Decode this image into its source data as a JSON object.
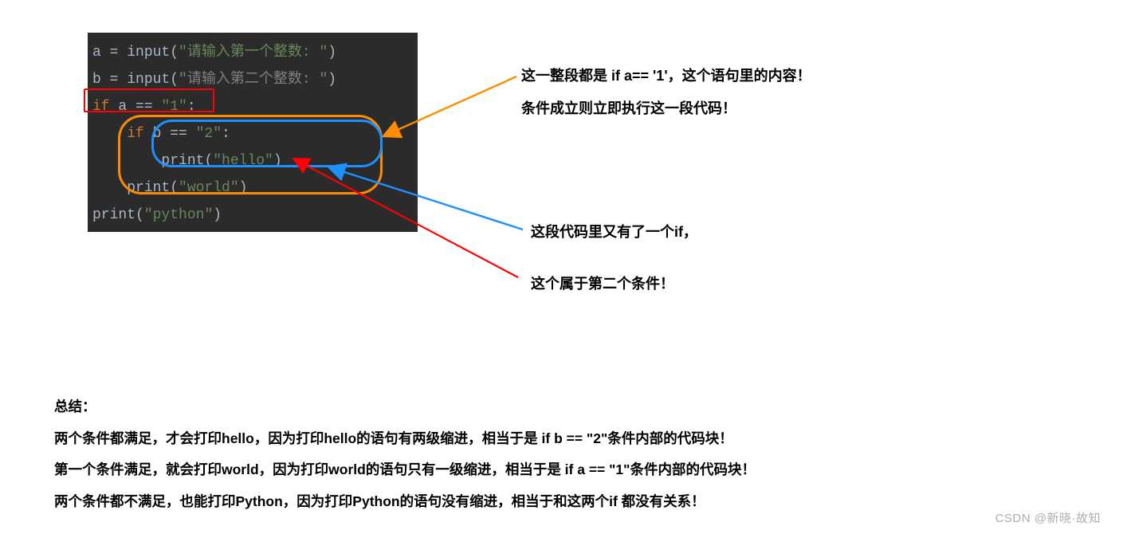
{
  "code": {
    "l1_a": "a = ",
    "l1_b": "input",
    "l1_c": "(",
    "l1_d": "\"请输入第一个整数: \"",
    "l1_e": ")",
    "l2_a": "b = ",
    "l2_b": "input",
    "l2_c": "(",
    "l2_d": "\"请输入第二个整数: \"",
    "l2_e": ")",
    "l3_a": "if",
    "l3_b": " a == ",
    "l3_c": "\"1\"",
    "l3_d": ":",
    "l4_a": "    if",
    "l4_b": " b == ",
    "l4_c": "\"2\"",
    "l4_d": ":",
    "l5_a": "        ",
    "l5_b": "print",
    "l5_c": "(",
    "l5_d": "\"hello\"",
    "l5_e": ")",
    "l6_a": "    ",
    "l6_b": "print",
    "l6_c": "(",
    "l6_d": "\"world\"",
    "l6_e": ")",
    "l7_a": "print",
    "l7_b": "(",
    "l7_c": "\"python\"",
    "l7_d": ")"
  },
  "annotations": {
    "orange_l1": "这一整段都是 if a== '1'，这个语句里的内容！",
    "orange_l2": "条件成立则立即执行这一段代码！",
    "blue_l1": "这段代码里又有了一个if，",
    "blue_l2": "这个属于第二个条件！"
  },
  "summary": {
    "title": "总结：",
    "p1": "两个条件都满足，才会打印hello，因为打印hello的语句有两级缩进，相当于是 if b == \"2\"条件内部的代码块！",
    "p2": "第一个条件满足，就会打印world，因为打印world的语句只有一级缩进，相当于是 if a == \"1\"条件内部的代码块！",
    "p3": "两个条件都不满足，也能打印Python，因为打印Python的语句没有缩进，相当于和这两个if 都没有关系！"
  },
  "watermark": "CSDN @新晓·故知",
  "colors": {
    "code_bg": "#2b2b2b",
    "orange": "#ff8c00",
    "blue": "#1e90ff",
    "red": "#ff0000"
  }
}
